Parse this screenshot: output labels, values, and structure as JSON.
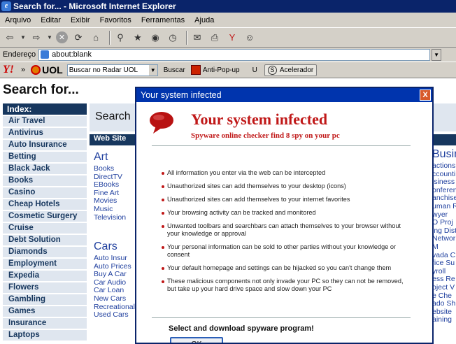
{
  "window": {
    "title": "Search for... - Microsoft Internet Explorer"
  },
  "menu": [
    "Arquivo",
    "Editar",
    "Exibir",
    "Favoritos",
    "Ferramentas",
    "Ajuda"
  ],
  "address": {
    "label": "Endereço",
    "value": "about:blank"
  },
  "links_bar": {
    "yahoo": "Y!",
    "chevron": "»",
    "uol": "UOL",
    "search_value": "Buscar no Radar UOL",
    "search_button": "Buscar",
    "anti_popup": "Anti-Pop-up",
    "u_label": "U",
    "accelerator": "Acelerador"
  },
  "page": {
    "title": "Search for...",
    "index_header": "Index:",
    "index_items": [
      "Air Travel",
      "Antivirus",
      "Auto Insurance",
      "Betting",
      "Black Jack",
      "Books",
      "Casino",
      "Cheap Hotels",
      "Cosmetic Surgery",
      "Cruise",
      "Debt Solution",
      "Diamonds",
      "Employment",
      "Expedia",
      "Flowers",
      "Gambling",
      "Games",
      "Insurance",
      "Laptops"
    ],
    "search_label": "Search",
    "web_site_label": "Web Site",
    "art": {
      "title": "Art",
      "items": [
        "Books",
        "DirectTV",
        "EBooks",
        "Fine Art",
        "Movies",
        "Music",
        "Television"
      ]
    },
    "cars": {
      "title": "Cars",
      "items": [
        "Auto Insur",
        "Auto Prices",
        "Buy A Car",
        "Car Audio",
        "Car Loan",
        "New Cars",
        "Recreational",
        "Used Cars"
      ]
    },
    "right_column": {
      "title": "Busine",
      "items": [
        "actions",
        "ccounti",
        "isiness",
        "onferen",
        "anchise",
        "uman R",
        "wyer",
        "O Proj",
        "ing Dist",
        "Networ",
        "M",
        "vada C",
        "fice Su",
        "yroll",
        "ess Re",
        "oject V",
        "e Che",
        "ado Sh",
        "ebsite",
        "aining"
      ]
    }
  },
  "dialog": {
    "window_title": "Your system infected",
    "close_label": "X",
    "heading": "Your system infected",
    "subheading": "Spyware online checker find 8 spy on your pc",
    "bullets": [
      "All information you enter via the web can be intercepted",
      "Unauthorized sites can add themselves to your desktop (icons)",
      "Unauthorized sites can add themselves to your internet favorites",
      "Your browsing activity can be tracked and monitored",
      "Unwanted toolbars and searchbars can attach themselves to your browser without your knowledge or approval",
      "Your personal information can be sold to other parties without your knowledge or consent",
      "Your default homepage and settings can be hijacked so you can't change them",
      "These malicious components not only invade your PC so they can not be removed, but take up your hard drive space and slow down your PC"
    ],
    "cta": "Select and download spyware program!",
    "ok_label": "OK"
  },
  "colors": {
    "titlebar": "#0a246a",
    "dialog_title": "#0034ad",
    "alert_red": "#c01818",
    "index_bg": "#dfe6ef",
    "navy": "#17375e"
  }
}
